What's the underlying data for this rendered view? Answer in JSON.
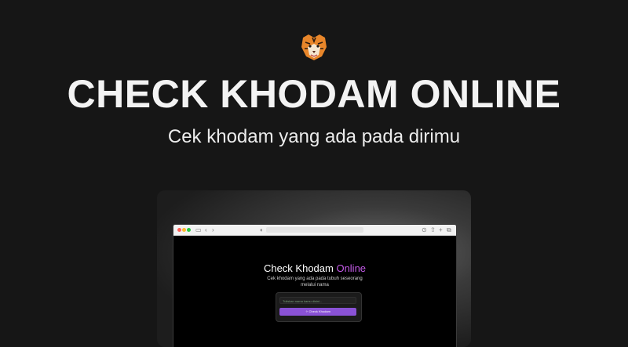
{
  "hero": {
    "logo_icon": "tiger-head-icon",
    "title": "CHECK KHODAM ONLINE",
    "subtitle": "Cek khodam yang ada pada dirimu"
  },
  "preview": {
    "browser": {
      "toolbar_icons": [
        "sidebar-icon",
        "back-icon",
        "forward-icon",
        "shield-icon",
        "download-icon",
        "share-icon",
        "new-tab-icon",
        "tabs-icon"
      ]
    },
    "page": {
      "title_main": "Check Khodam ",
      "title_accent": "Online",
      "description": "Cek khodam yang ada pada tubuh seseorang melalui nama",
      "input_placeholder": "Tuliskan nama kamu disini...",
      "button_label": "Check Khodam"
    }
  },
  "colors": {
    "background": "#161616",
    "accent_purple": "#c45ae8",
    "button_purple": "#8a52d6"
  }
}
